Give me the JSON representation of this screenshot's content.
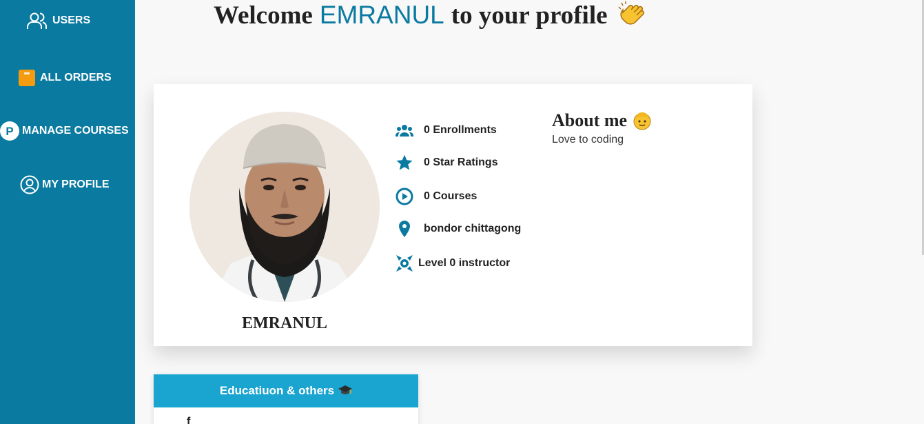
{
  "sidebar": {
    "items": [
      {
        "label": "USERS",
        "icon": "users-icon"
      },
      {
        "label": "ALL ORDERS",
        "icon": "orders-box-icon"
      },
      {
        "label": "MANAGE COURSES",
        "icon": "p-circle-icon"
      },
      {
        "label": "MY PROFILE",
        "icon": "user-circle-icon"
      }
    ]
  },
  "header": {
    "prefix": "Welcome",
    "name": "EMRANUL",
    "suffix": "to your profile",
    "emoji": "clapping-hands-icon"
  },
  "profile": {
    "name": "EMRANUL",
    "stats": [
      {
        "text": "0 Enrollments",
        "icon": "people-icon"
      },
      {
        "text": "0 Star Ratings",
        "icon": "star-icon"
      },
      {
        "text": "0 Courses",
        "icon": "play-circle-icon"
      },
      {
        "text": "bondor chittagong",
        "icon": "location-pin-icon"
      },
      {
        "text": "Level 0 instructor",
        "icon": "level-badge-icon"
      }
    ],
    "about_title": "About me",
    "about_text": "Love to coding"
  },
  "education": {
    "title": "Educatiuon & others",
    "first_row_fragment": "f"
  },
  "colors": {
    "sidebar": "#0b7aa0",
    "accent": "#0b7aa0",
    "edu_header": "#1aa4d0",
    "orders_icon": "#f59b10"
  }
}
